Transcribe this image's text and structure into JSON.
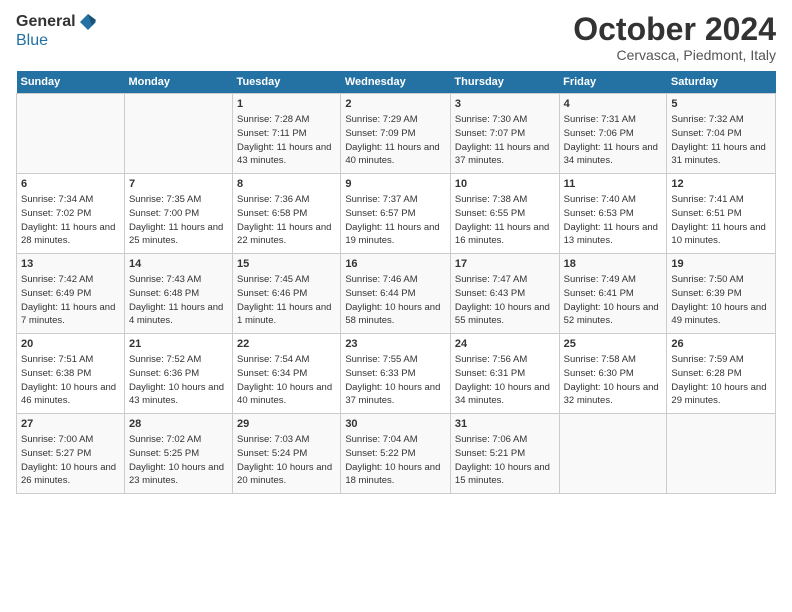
{
  "header": {
    "logo_general": "General",
    "logo_blue": "Blue",
    "main_title": "October 2024",
    "subtitle": "Cervasca, Piedmont, Italy"
  },
  "calendar": {
    "days_of_week": [
      "Sunday",
      "Monday",
      "Tuesday",
      "Wednesday",
      "Thursday",
      "Friday",
      "Saturday"
    ],
    "weeks": [
      [
        {
          "day": "",
          "detail": ""
        },
        {
          "day": "",
          "detail": ""
        },
        {
          "day": "1",
          "detail": "Sunrise: 7:28 AM\nSunset: 7:11 PM\nDaylight: 11 hours and 43 minutes."
        },
        {
          "day": "2",
          "detail": "Sunrise: 7:29 AM\nSunset: 7:09 PM\nDaylight: 11 hours and 40 minutes."
        },
        {
          "day": "3",
          "detail": "Sunrise: 7:30 AM\nSunset: 7:07 PM\nDaylight: 11 hours and 37 minutes."
        },
        {
          "day": "4",
          "detail": "Sunrise: 7:31 AM\nSunset: 7:06 PM\nDaylight: 11 hours and 34 minutes."
        },
        {
          "day": "5",
          "detail": "Sunrise: 7:32 AM\nSunset: 7:04 PM\nDaylight: 11 hours and 31 minutes."
        }
      ],
      [
        {
          "day": "6",
          "detail": "Sunrise: 7:34 AM\nSunset: 7:02 PM\nDaylight: 11 hours and 28 minutes."
        },
        {
          "day": "7",
          "detail": "Sunrise: 7:35 AM\nSunset: 7:00 PM\nDaylight: 11 hours and 25 minutes."
        },
        {
          "day": "8",
          "detail": "Sunrise: 7:36 AM\nSunset: 6:58 PM\nDaylight: 11 hours and 22 minutes."
        },
        {
          "day": "9",
          "detail": "Sunrise: 7:37 AM\nSunset: 6:57 PM\nDaylight: 11 hours and 19 minutes."
        },
        {
          "day": "10",
          "detail": "Sunrise: 7:38 AM\nSunset: 6:55 PM\nDaylight: 11 hours and 16 minutes."
        },
        {
          "day": "11",
          "detail": "Sunrise: 7:40 AM\nSunset: 6:53 PM\nDaylight: 11 hours and 13 minutes."
        },
        {
          "day": "12",
          "detail": "Sunrise: 7:41 AM\nSunset: 6:51 PM\nDaylight: 11 hours and 10 minutes."
        }
      ],
      [
        {
          "day": "13",
          "detail": "Sunrise: 7:42 AM\nSunset: 6:49 PM\nDaylight: 11 hours and 7 minutes."
        },
        {
          "day": "14",
          "detail": "Sunrise: 7:43 AM\nSunset: 6:48 PM\nDaylight: 11 hours and 4 minutes."
        },
        {
          "day": "15",
          "detail": "Sunrise: 7:45 AM\nSunset: 6:46 PM\nDaylight: 11 hours and 1 minute."
        },
        {
          "day": "16",
          "detail": "Sunrise: 7:46 AM\nSunset: 6:44 PM\nDaylight: 10 hours and 58 minutes."
        },
        {
          "day": "17",
          "detail": "Sunrise: 7:47 AM\nSunset: 6:43 PM\nDaylight: 10 hours and 55 minutes."
        },
        {
          "day": "18",
          "detail": "Sunrise: 7:49 AM\nSunset: 6:41 PM\nDaylight: 10 hours and 52 minutes."
        },
        {
          "day": "19",
          "detail": "Sunrise: 7:50 AM\nSunset: 6:39 PM\nDaylight: 10 hours and 49 minutes."
        }
      ],
      [
        {
          "day": "20",
          "detail": "Sunrise: 7:51 AM\nSunset: 6:38 PM\nDaylight: 10 hours and 46 minutes."
        },
        {
          "day": "21",
          "detail": "Sunrise: 7:52 AM\nSunset: 6:36 PM\nDaylight: 10 hours and 43 minutes."
        },
        {
          "day": "22",
          "detail": "Sunrise: 7:54 AM\nSunset: 6:34 PM\nDaylight: 10 hours and 40 minutes."
        },
        {
          "day": "23",
          "detail": "Sunrise: 7:55 AM\nSunset: 6:33 PM\nDaylight: 10 hours and 37 minutes."
        },
        {
          "day": "24",
          "detail": "Sunrise: 7:56 AM\nSunset: 6:31 PM\nDaylight: 10 hours and 34 minutes."
        },
        {
          "day": "25",
          "detail": "Sunrise: 7:58 AM\nSunset: 6:30 PM\nDaylight: 10 hours and 32 minutes."
        },
        {
          "day": "26",
          "detail": "Sunrise: 7:59 AM\nSunset: 6:28 PM\nDaylight: 10 hours and 29 minutes."
        }
      ],
      [
        {
          "day": "27",
          "detail": "Sunrise: 7:00 AM\nSunset: 5:27 PM\nDaylight: 10 hours and 26 minutes."
        },
        {
          "day": "28",
          "detail": "Sunrise: 7:02 AM\nSunset: 5:25 PM\nDaylight: 10 hours and 23 minutes."
        },
        {
          "day": "29",
          "detail": "Sunrise: 7:03 AM\nSunset: 5:24 PM\nDaylight: 10 hours and 20 minutes."
        },
        {
          "day": "30",
          "detail": "Sunrise: 7:04 AM\nSunset: 5:22 PM\nDaylight: 10 hours and 18 minutes."
        },
        {
          "day": "31",
          "detail": "Sunrise: 7:06 AM\nSunset: 5:21 PM\nDaylight: 10 hours and 15 minutes."
        },
        {
          "day": "",
          "detail": ""
        },
        {
          "day": "",
          "detail": ""
        }
      ]
    ]
  }
}
